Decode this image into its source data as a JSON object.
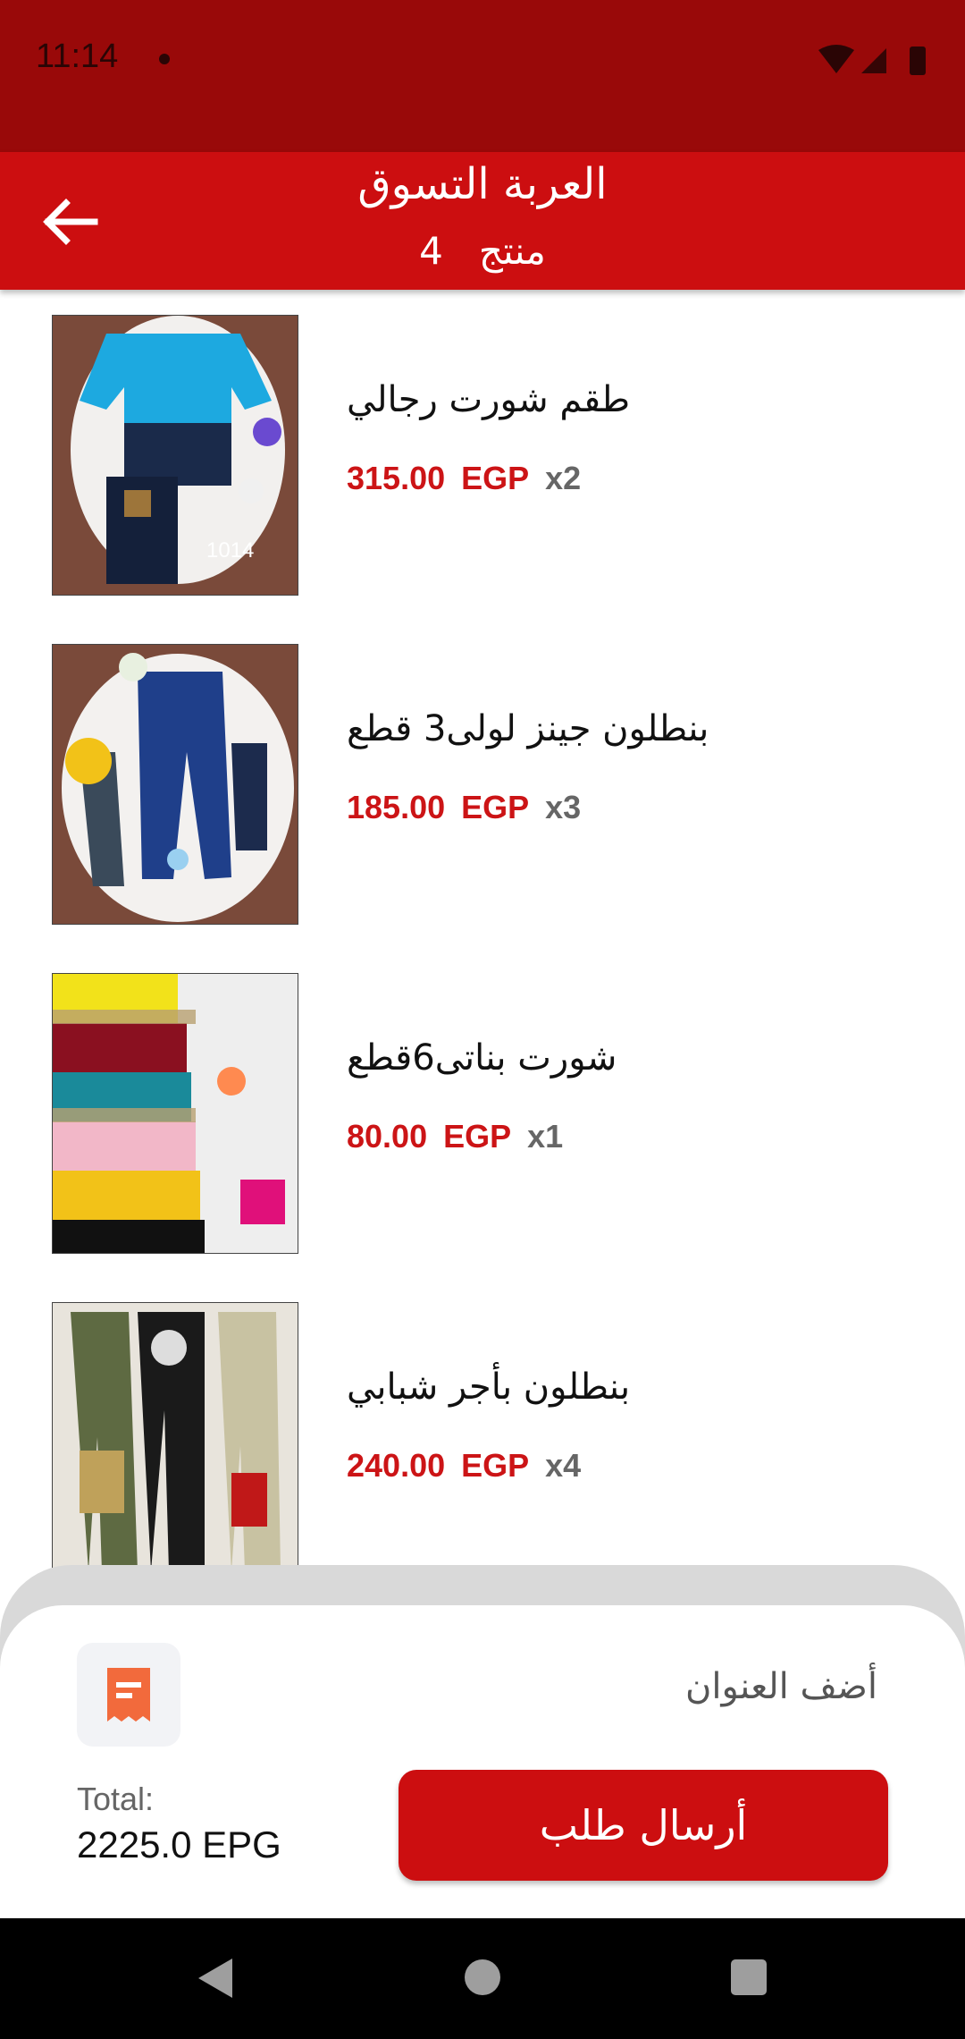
{
  "status_bar": {
    "time": "11:14"
  },
  "app_bar": {
    "title": "العربة التسوق",
    "count_label": "منتج",
    "count": "4"
  },
  "items": [
    {
      "name": "طقم شورت رجالي",
      "price": "315.00",
      "currency": "EGP",
      "qty": "x2"
    },
    {
      "name": "بنطلون جينز لولى3 قطع",
      "price": "185.00",
      "currency": "EGP",
      "qty": "x3"
    },
    {
      "name": "شورت بناتى6قطع",
      "price": "80.00",
      "currency": "EGP",
      "qty": "x1"
    },
    {
      "name": "بنطلون بأجر شبابي",
      "price": "240.00",
      "currency": "EGP",
      "qty": "x4"
    }
  ],
  "bottom": {
    "address_label": "أضف العنوان",
    "total_label": "Total:",
    "total_value": "2225.0 EPG",
    "send_label": "أرسال طلب"
  },
  "colors": {
    "primary": "#cc0e10",
    "status": "#990909",
    "price": "#cc1416"
  },
  "icons": [
    "arrow-left-icon",
    "invoice-icon",
    "wifi-icon",
    "signal-icon",
    "battery-icon"
  ]
}
